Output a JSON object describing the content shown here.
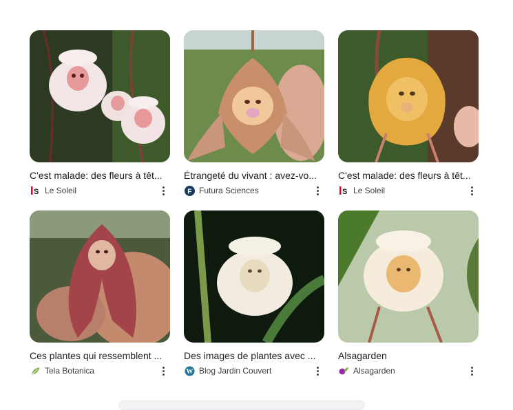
{
  "results": [
    {
      "title": "C'est malade: des fleurs à têt...",
      "source": "Le Soleil",
      "favicon": "le-soleil-icon"
    },
    {
      "title": "Étrangeté du vivant : avez-vo...",
      "source": "Futura Sciences",
      "favicon": "futura-sciences-icon"
    },
    {
      "title": "C'est malade: des fleurs à têt...",
      "source": "Le Soleil",
      "favicon": "le-soleil-icon"
    },
    {
      "title": "Ces plantes qui ressemblent ...",
      "source": "Tela Botanica",
      "favicon": "tela-botanica-icon"
    },
    {
      "title": "Des images de plantes avec ...",
      "source": "Blog Jardin Couvert",
      "favicon": "wordpress-icon"
    },
    {
      "title": "Alsagarden",
      "source": "Alsagarden",
      "favicon": "alsagarden-icon"
    }
  ],
  "colors": {
    "le_soleil": "#c8102e",
    "futura": "#1b3a5c",
    "tela": "#7cb342",
    "wordpress": "#21759b",
    "alsagarden": "#9c27b0"
  }
}
